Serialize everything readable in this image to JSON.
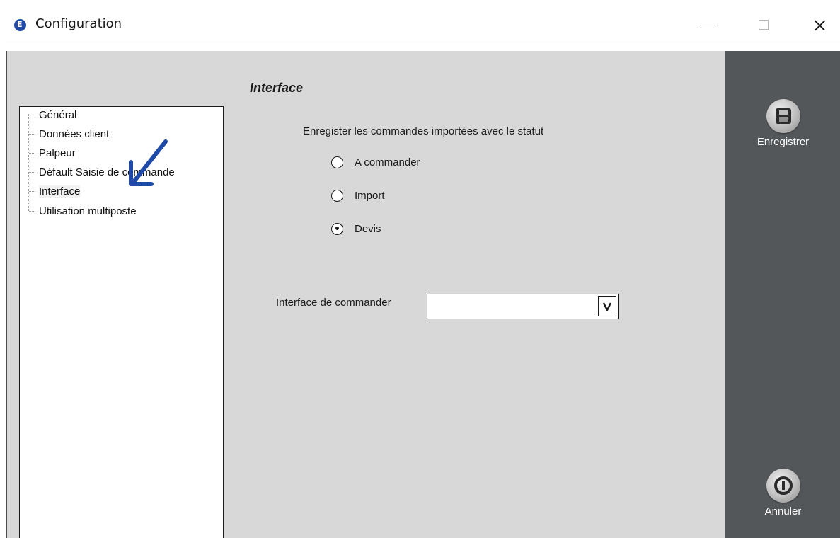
{
  "window": {
    "title": "Configuration"
  },
  "tree": {
    "items": [
      {
        "label": "Général"
      },
      {
        "label": "Données client"
      },
      {
        "label": "Palpeur"
      },
      {
        "label": "Défault Saisie de commande"
      },
      {
        "label": "Interface"
      },
      {
        "label": "Utilisation multiposte"
      }
    ],
    "selected": "Interface"
  },
  "form": {
    "section_title": "Interface",
    "status_label": "Enregister les commandes importées avec le statut",
    "radios": [
      {
        "label": "A commander",
        "checked": false
      },
      {
        "label": "Import",
        "checked": false
      },
      {
        "label": "Devis",
        "checked": true
      }
    ],
    "interface_label": "Interface de commander",
    "interface_value": ""
  },
  "actions": {
    "save_label": "Enregistrer",
    "cancel_label": "Annuler"
  },
  "colors": {
    "client_bg": "#d8d8d8",
    "action_panel": "#54575a",
    "annotation_arrow": "#1f4aa8",
    "app_icon": "#1f4aa8"
  },
  "icons": {
    "app": "app-logo-icon",
    "save": "floppy-disk-icon",
    "cancel": "power-icon",
    "dropdown": "chevron-down-icon",
    "annotation": "arrow-annotation-icon"
  }
}
